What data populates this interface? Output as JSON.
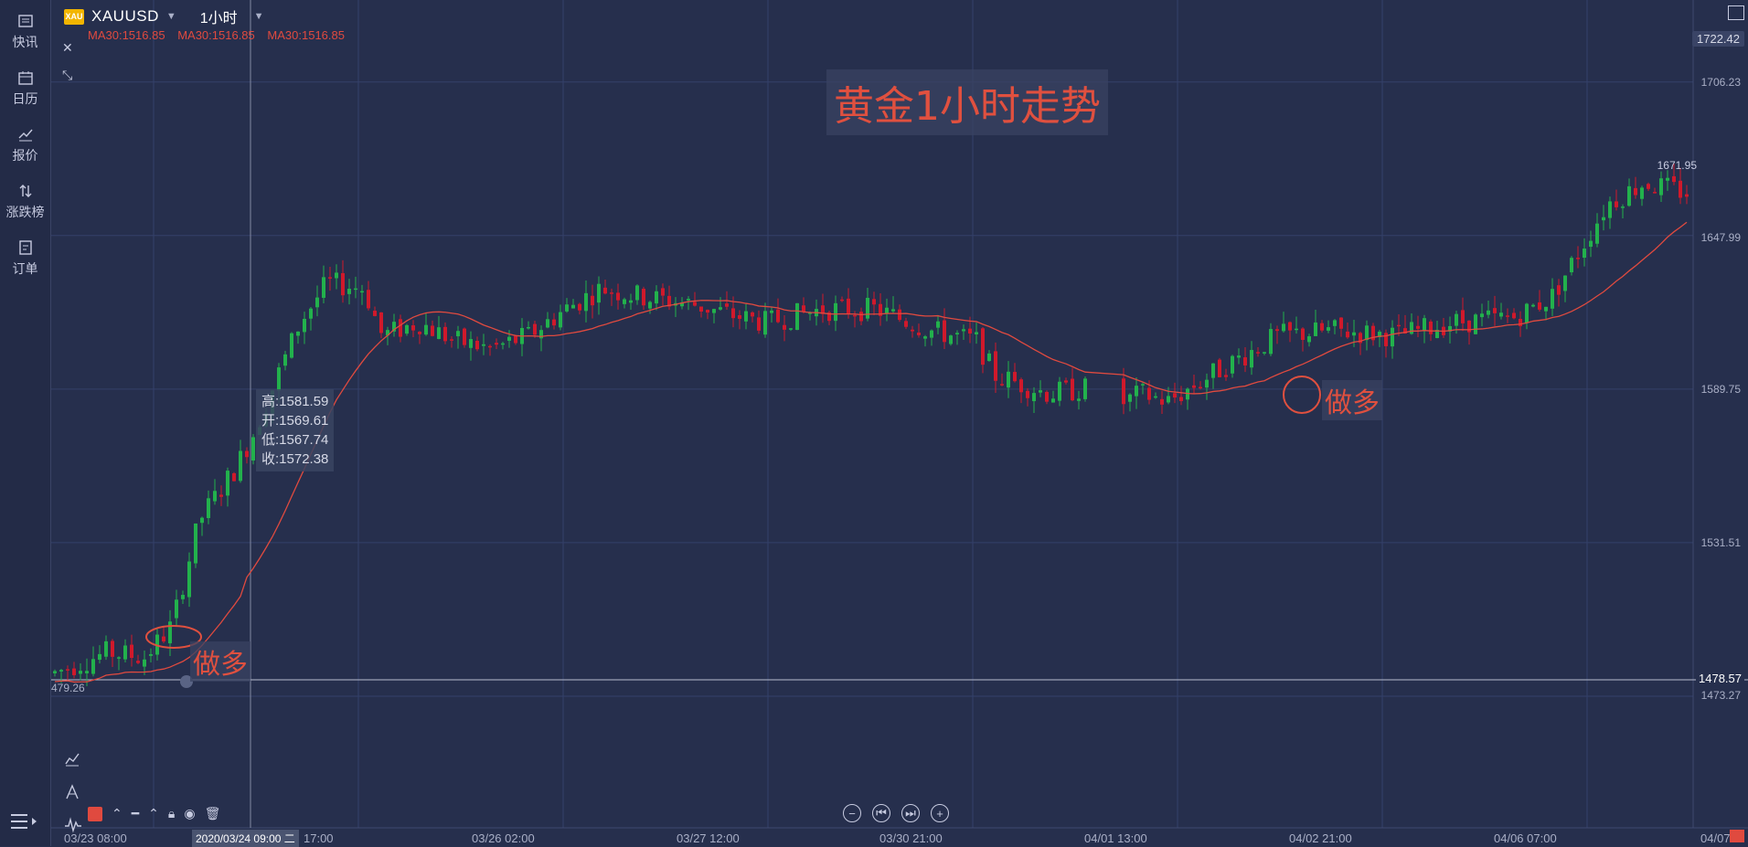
{
  "sidebar": {
    "items": [
      {
        "label": "快讯",
        "icon": "news-icon"
      },
      {
        "label": "日历",
        "icon": "calendar-icon"
      },
      {
        "label": "报价",
        "icon": "quote-chart-icon"
      },
      {
        "label": "涨跌榜",
        "icon": "updown-arrows-icon"
      },
      {
        "label": "订单",
        "icon": "order-icon"
      }
    ]
  },
  "header": {
    "logo_text": "XAU",
    "symbol": "XAUUSD",
    "period": "1小时"
  },
  "ma": [
    "MA30:1516.85",
    "MA30:1516.85",
    "MA30:1516.85"
  ],
  "title": "黄金1小时走势",
  "ohlc": {
    "high": "高:1581.59",
    "open": "开:1569.61",
    "low": "低:1567.74",
    "close": "收:1572.38"
  },
  "annotations": {
    "long1": "做多",
    "long2": "做多"
  },
  "price_axis": [
    "1706.23",
    "1647.99",
    "1589.75",
    "1531.51",
    "1473.27"
  ],
  "price_top": "1722.42",
  "price_current": "1478.57",
  "high_marker": "1671.95",
  "low_marker": "479.26",
  "time_axis": [
    "03/23 08:00",
    "17:00",
    "03/26 02:00",
    "03/27 12:00",
    "03/30 21:00",
    "04/01 13:00",
    "04/02 21:00",
    "04/06 07:00",
    "04/07"
  ],
  "time_cursor": "2020/03/24 09:00 二",
  "colors": {
    "background": "#262f4d",
    "up": "#22b14c",
    "down": "#d0192b",
    "ma_line": "#e04a3f",
    "annotation": "#e0503f"
  },
  "chart_data": {
    "type": "candlestick",
    "indicator": "MA30",
    "y_range": [
      1473.27,
      1722.42
    ],
    "anchor_points": [
      {
        "x": "03/23 08:00",
        "price": 1482
      },
      {
        "x": "03/24 09:00",
        "price": 1572.38
      },
      {
        "x": "03/25",
        "price": 1625
      },
      {
        "x": "03/26 02:00",
        "price": 1620
      },
      {
        "x": "03/27 12:00",
        "price": 1632
      },
      {
        "x": "03/30 21:00",
        "price": 1620
      },
      {
        "x": "04/01 13:00",
        "price": 1585
      },
      {
        "x": "04/02 21:00",
        "price": 1595
      },
      {
        "x": "04/06 07:00",
        "price": 1620
      },
      {
        "x": "04/07",
        "price": 1660
      }
    ]
  }
}
